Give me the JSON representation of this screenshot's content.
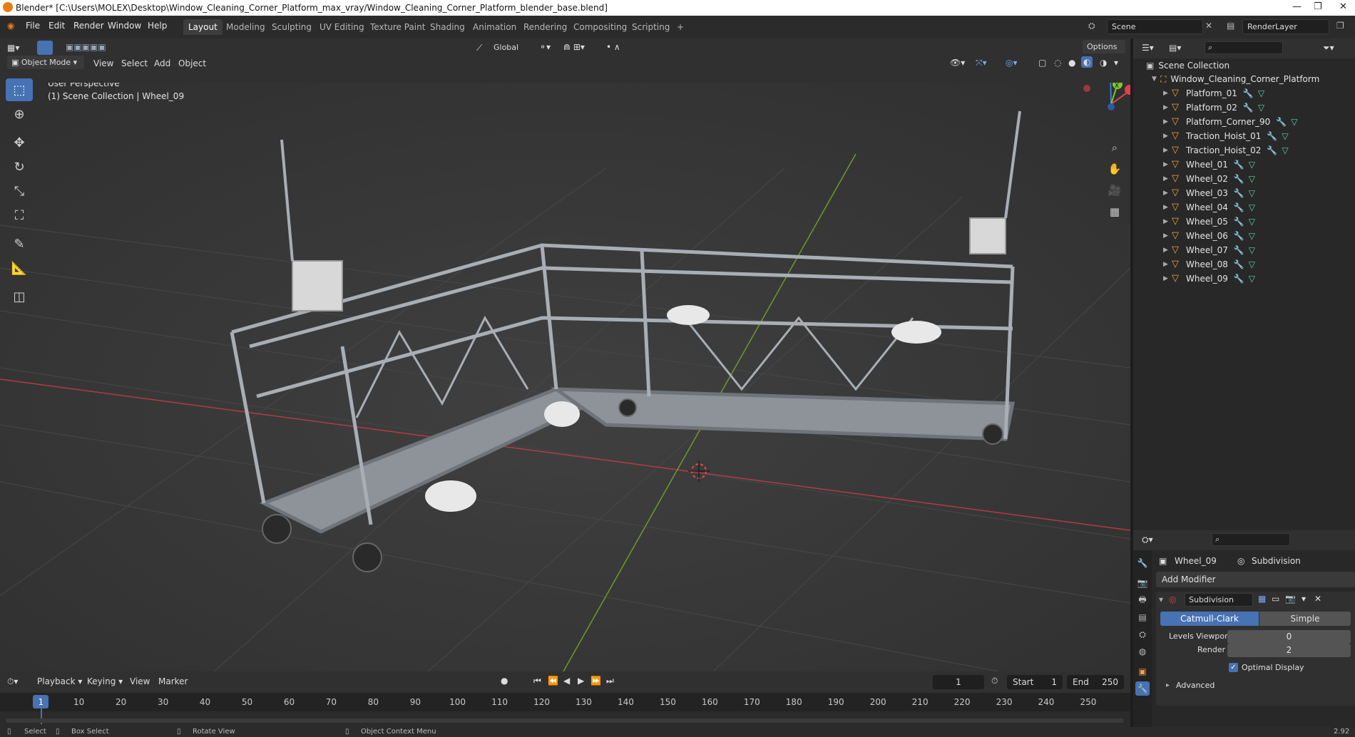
{
  "titlebar": {
    "title": "Blender* [C:\\Users\\MOLEX\\Desktop\\Window_Cleaning_Corner_Platform_max_vray/Window_Cleaning_Corner_Platform_blender_base.blend]",
    "minimize": "—",
    "restore": "❐",
    "close": "✕"
  },
  "menu": {
    "file": "File",
    "edit": "Edit",
    "render": "Render",
    "window": "Window",
    "help": "Help"
  },
  "workspaces": [
    "Layout",
    "Modeling",
    "Sculpting",
    "UV Editing",
    "Texture Paint",
    "Shading",
    "Animation",
    "Rendering",
    "Compositing",
    "Scripting"
  ],
  "workspace_add": "+",
  "scene": {
    "name": "Scene",
    "render_layer": "RenderLayer"
  },
  "viewport_header": {
    "transform_orientation": "Global",
    "options": "Options",
    "mode": "Object Mode",
    "view": "View",
    "select": "Select",
    "add": "Add",
    "object": "Object"
  },
  "viewport": {
    "perspective": "User Perspective",
    "collection_info": "(1) Scene Collection | Wheel_09",
    "gizmo": {
      "x": "X",
      "y": "Y",
      "z": "Z"
    }
  },
  "outliner": {
    "root": "Scene Collection",
    "collection": "Window_Cleaning_Corner_Platform",
    "objects": [
      "Platform_01",
      "Platform_02",
      "Platform_Corner_90",
      "Traction_Hoist_01",
      "Traction_Hoist_02",
      "Wheel_01",
      "Wheel_02",
      "Wheel_03",
      "Wheel_04",
      "Wheel_05",
      "Wheel_06",
      "Wheel_07",
      "Wheel_08",
      "Wheel_09"
    ],
    "selected": "Wheel_09"
  },
  "properties": {
    "object": "Wheel_09",
    "modifier_context": "Subdivision",
    "add_modifier": "Add Modifier",
    "modifier_name": "Subdivision",
    "type_options": [
      "Catmull-Clark",
      "Simple"
    ],
    "active_type": "Catmull-Clark",
    "levels_viewport_label": "Levels Viewport",
    "levels_viewport": "0",
    "render_label": "Render",
    "render": "2",
    "optimal_display": "Optimal Display",
    "advanced": "Advanced"
  },
  "timeline": {
    "playback": "Playback",
    "keying": "Keying",
    "view": "View",
    "marker": "Marker",
    "current_frame": "1",
    "start_label": "Start",
    "start": "1",
    "end_label": "End",
    "end": "250",
    "ticks": [
      "1",
      "10",
      "20",
      "30",
      "40",
      "50",
      "60",
      "70",
      "80",
      "90",
      "100",
      "110",
      "120",
      "130",
      "140",
      "150",
      "160",
      "170",
      "180",
      "190",
      "200",
      "210",
      "220",
      "230",
      "240",
      "250"
    ]
  },
  "statusbar": {
    "select": "Select",
    "box_select": "Box Select",
    "rotate_view": "Rotate View",
    "context_menu": "Object Context Menu",
    "version": "2.92"
  },
  "colors": {
    "accent": "#4772b3",
    "x_axis": "#e0404d",
    "y_axis": "#7ec82e",
    "z_axis": "#2f7fe0",
    "mesh_icon": "#f2a040"
  }
}
